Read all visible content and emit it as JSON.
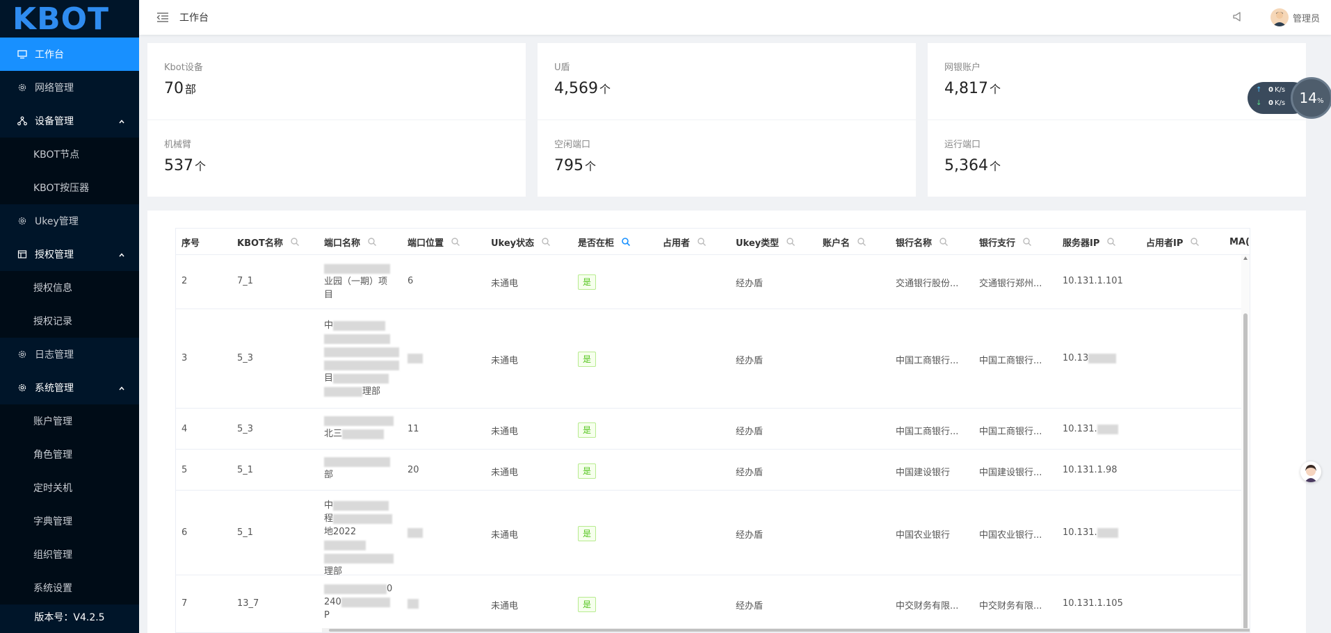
{
  "logo": "KBOT",
  "sidebar": {
    "items": [
      {
        "label": "工作台",
        "icon": "monitor-icon"
      },
      {
        "label": "网络管理",
        "icon": "gear-icon"
      },
      {
        "label": "设备管理",
        "icon": "network-icon"
      },
      {
        "label": "KBOT节点"
      },
      {
        "label": "KBOT按压器"
      },
      {
        "label": "Ukey管理",
        "icon": "gear-icon"
      },
      {
        "label": "授权管理",
        "icon": "table-icon"
      },
      {
        "label": "授权信息"
      },
      {
        "label": "授权记录"
      },
      {
        "label": "日志管理",
        "icon": "gear-icon"
      },
      {
        "label": "系统管理",
        "icon": "gear-icon"
      },
      {
        "label": "账户管理"
      },
      {
        "label": "角色管理"
      },
      {
        "label": "定时关机"
      },
      {
        "label": "字典管理"
      },
      {
        "label": "组织管理"
      },
      {
        "label": "系统设置"
      }
    ],
    "version": "版本号：V4.2.5"
  },
  "header": {
    "breadcrumb": "工作台",
    "user": "管理员"
  },
  "stats": [
    {
      "label": "Kbot设备",
      "value": "70",
      "unit": "部"
    },
    {
      "label": "U盾",
      "value": "4,569",
      "unit": "个"
    },
    {
      "label": "网银账户",
      "value": "4,817",
      "unit": "个"
    },
    {
      "label": "机械臂",
      "value": "537",
      "unit": "个"
    },
    {
      "label": "空闲端口",
      "value": "795",
      "unit": "个"
    },
    {
      "label": "运行端口",
      "value": "5,364",
      "unit": "个"
    }
  ],
  "table": {
    "columns": [
      "序号",
      "KBOT名称",
      "端口名称",
      "端口位置",
      "Ukey状态",
      "是否在柜",
      "占用者",
      "Ukey类型",
      "账户名",
      "银行名称",
      "银行支行",
      "服务器IP",
      "占用者IP",
      "MA("
    ],
    "rows": [
      {
        "no": "2",
        "kbot": "7_1",
        "port_name": [
          "",
          "业园（一期）项",
          "目"
        ],
        "pos": "6",
        "status": "未通电",
        "in_cabinet": "是",
        "ukey_type": "经办盾",
        "bank": "交通银行股份...",
        "branch": "交通银行郑州...",
        "server_ip": "10.131.1.101"
      },
      {
        "no": "3",
        "kbot": "5_3",
        "port_name": [
          "中",
          "",
          "",
          "",
          "目",
          "理部"
        ],
        "pos": "",
        "status": "未通电",
        "in_cabinet": "是",
        "ukey_type": "经办盾",
        "bank": "中国工商银行...",
        "branch": "中国工商银行...",
        "server_ip": "10.13"
      },
      {
        "no": "4",
        "kbot": "5_3",
        "port_name": [
          "",
          "北三"
        ],
        "pos": "11",
        "status": "未通电",
        "in_cabinet": "是",
        "ukey_type": "经办盾",
        "bank": "中国工商银行...",
        "branch": "中国工商银行...",
        "server_ip": "10.131."
      },
      {
        "no": "5",
        "kbot": "5_1",
        "port_name": [
          "",
          "部"
        ],
        "pos": "20",
        "status": "未通电",
        "in_cabinet": "是",
        "ukey_type": "经办盾",
        "bank": "中国建设银行",
        "branch": "中国建设银行...",
        "server_ip": "10.131.1.98"
      },
      {
        "no": "6",
        "kbot": "5_1",
        "port_name": [
          "中",
          "程",
          "地2022",
          "",
          "理部"
        ],
        "pos": "",
        "status": "未通电",
        "in_cabinet": "是",
        "ukey_type": "经办盾",
        "bank": "中国农业银行",
        "branch": "中国农业银行...",
        "server_ip": "10.131."
      },
      {
        "no": "7",
        "kbot": "13_7",
        "port_name": [
          "0",
          "240",
          "P"
        ],
        "pos": "",
        "status": "未通电",
        "in_cabinet": "是",
        "ukey_type": "经办盾",
        "bank": "中交财务有限...",
        "branch": "中交财务有限...",
        "server_ip": "10.131.1.105"
      }
    ]
  },
  "speed_widget": {
    "up": "0",
    "down": "0",
    "unit": "K/s",
    "percent": "14",
    "percent_unit": "%"
  }
}
